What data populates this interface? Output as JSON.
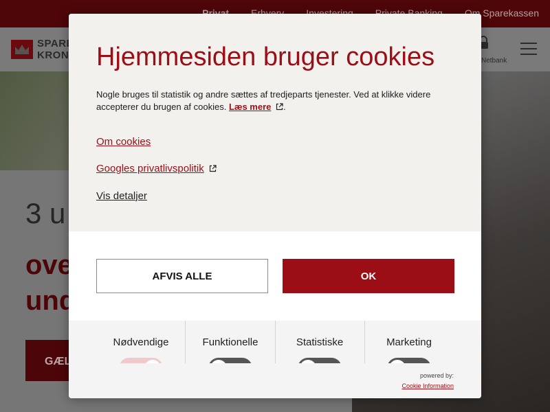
{
  "background": {
    "top_nav": [
      "Privat",
      "Erhverv",
      "Investering",
      "Private Banking",
      "Om Sparekassen"
    ],
    "logo_text": [
      "SPAREKASSEN",
      "KRONJYLLAND"
    ],
    "netbank_label": "Netbank",
    "promo_line1": "3 u",
    "promo_line2": [
      "ove",
      "und"
    ],
    "promo_button": "GÆL"
  },
  "dialog": {
    "title": "Hjemmesiden bruger cookies",
    "body_text": "Nogle bruges til statistik og andre sættes af tredjeparts tjenester. Ved at klikke videre accepterer du brugen af cookies.",
    "read_more": "Læs mere",
    "body_end": ".",
    "link_about": "Om cookies",
    "link_google": "Googles privatlivspolitik",
    "link_details": "Vis detaljer",
    "reject_label": "AFVIS ALLE",
    "ok_label": "OK",
    "categories": [
      {
        "label": "Nødvendige",
        "on": true
      },
      {
        "label": "Funktionelle",
        "on": false
      },
      {
        "label": "Statistiske",
        "on": false
      },
      {
        "label": "Marketing",
        "on": false
      }
    ],
    "powered_by": "powered by:",
    "powered_link": "Cookie Information"
  },
  "colors": {
    "brand_red": "#9c0e15",
    "toggle_on": "#f0c9cb",
    "toggle_off": "#555555"
  }
}
